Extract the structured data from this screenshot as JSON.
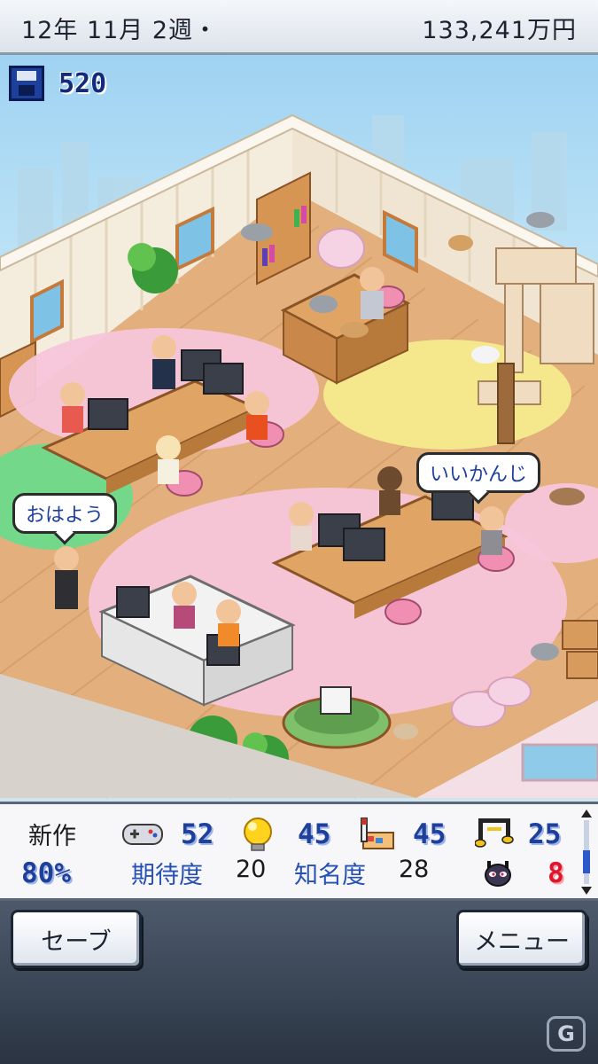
{
  "status_bar": {
    "date": "12年  11月  2週・",
    "funds": "133,241万円"
  },
  "scene": {
    "research_points": "520",
    "speech_bubbles": [
      "おはよう",
      "いいかんじ"
    ]
  },
  "stats_panel": {
    "project_label": "新作",
    "progress": "80%",
    "fun_value": "52",
    "creativity_value": "45",
    "graphics_value": "45",
    "sound_value": "25",
    "expectation_label": "期待度",
    "expectation_value": "20",
    "fame_label": "知名度",
    "fame_value": "28",
    "bugs_value": "8"
  },
  "buttons": {
    "save": "セーブ",
    "menu": "メニュー"
  },
  "watermark": "G",
  "colors": {
    "stat_blue": "#1e3f9a",
    "bug_red": "#e0152b",
    "label_blue": "#2650b4"
  },
  "icons": [
    "floppy-disk-icon",
    "gamepad-icon",
    "lightbulb-icon",
    "paintbrush-icon",
    "music-note-icon",
    "bug-icon"
  ]
}
